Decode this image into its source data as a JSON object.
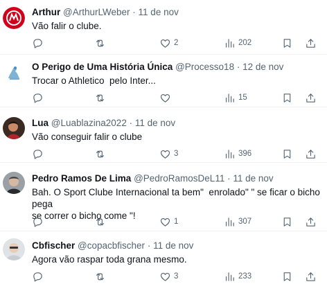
{
  "tweets": [
    {
      "name": "Arthur",
      "handle": "@ArthurLWeber",
      "date": "11 de nov",
      "text": "Vão falir o clube.",
      "replies": "",
      "retweets": "",
      "likes": "2",
      "views": "202",
      "avatar_icon": "internacional-crest"
    },
    {
      "name": "O Perigo de Uma História Única",
      "handle": "@Processo18",
      "date": "12 de nov",
      "text": "Trocar o Athletico  pelo Inter...",
      "replies": "",
      "retweets": "",
      "likes": "",
      "views": "15",
      "avatar_icon": "kafka-illustration"
    },
    {
      "name": "Lua",
      "handle": "@Luablazina2022",
      "date": "11 de nov",
      "text": "Vão conseguir falir o clube",
      "replies": "",
      "retweets": "",
      "likes": "3",
      "views": "396",
      "avatar_icon": "person-photo"
    },
    {
      "name": "Pedro Ramos De Lima",
      "handle": "@PedroRamosDeL11",
      "date": "11 de nov",
      "text": "Bah. O Sport Clube Internacional ta bem\"  enrolado\" \" se ficar o bicho pega\nse correr o bicho come \"!",
      "replies": "",
      "retweets": "",
      "likes": "1",
      "views": "307",
      "avatar_icon": "person-photo"
    },
    {
      "name": "Cbfischer",
      "handle": "@copacbfischer",
      "date": "11 de nov",
      "text": "Agora vão raspar toda grana mesmo.",
      "replies": "",
      "retweets": "",
      "likes": "3",
      "views": "233",
      "avatar_icon": "person-photo"
    }
  ],
  "separator": "·",
  "colors": {
    "text": "#0f1419",
    "muted": "#536471",
    "border": "#eff3f4",
    "inter_red": "#d0021b"
  }
}
